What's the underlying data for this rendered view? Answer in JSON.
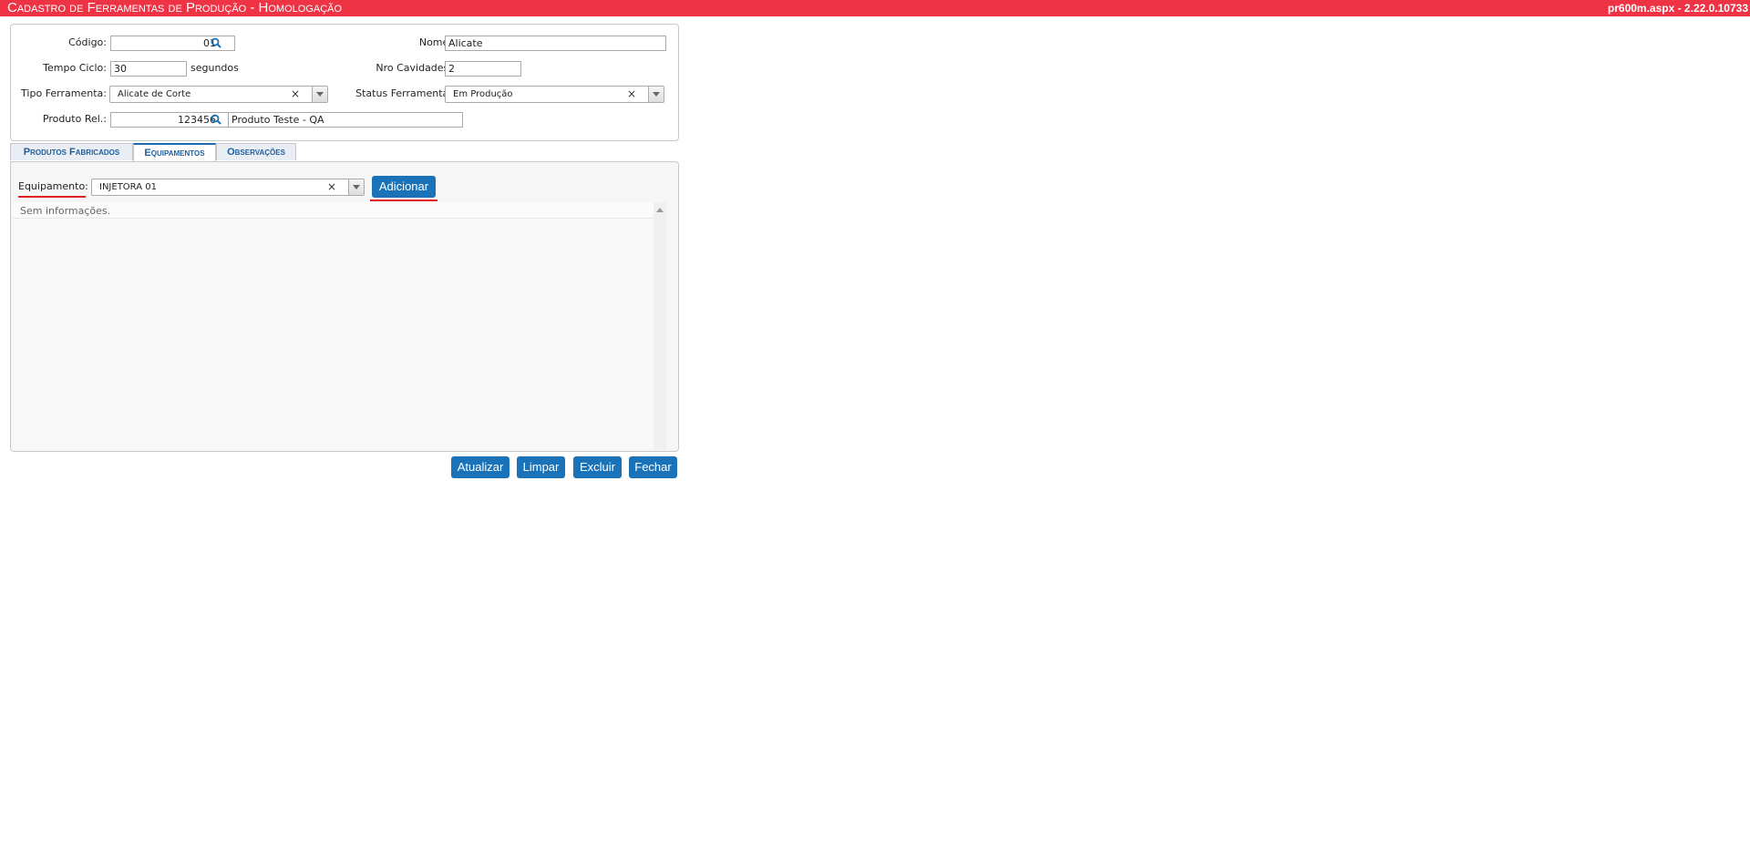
{
  "header": {
    "title": "Cadastro de Ferramentas de Produção  - Homologação",
    "version": "pr600m.aspx - 2.22.0.10733",
    "color": "#ee3344"
  },
  "form": {
    "codigo_label": "Código:",
    "codigo_value": "01",
    "nome_label": "Nome:",
    "nome_value": "Alicate",
    "tempo_ciclo_label": "Tempo Ciclo:",
    "tempo_ciclo_value": "30",
    "tempo_ciclo_unit": "segundos",
    "nro_cavidades_label": "Nro Cavidades:",
    "nro_cavidades_value": "2",
    "tipo_ferramenta_label": "Tipo Ferramenta:",
    "tipo_ferramenta_value": "Alicate de Corte",
    "status_ferramenta_label": "Status Ferramenta:",
    "status_ferramenta_value": "Em Produção",
    "produto_rel_label": "Produto Rel.:",
    "produto_rel_code": "123456",
    "produto_rel_desc": "Produto Teste - QA"
  },
  "tabs": [
    {
      "label": "Produtos Fabricados",
      "active": false
    },
    {
      "label": "Equipamentos",
      "active": true
    },
    {
      "label": "Observações",
      "active": false
    }
  ],
  "equipamentos": {
    "label": "Equipamento:",
    "selected": "INJETORA 01",
    "add_button": "Adicionar",
    "empty_message": "Sem informações."
  },
  "actions": {
    "atualizar": "Atualizar",
    "limpar": "Limpar",
    "excluir": "Excluir",
    "fechar": "Fechar"
  },
  "icons": {
    "search": "search-icon",
    "clear": "×"
  },
  "colors": {
    "accent": "#1a73b8",
    "highlight": "#e02020"
  }
}
